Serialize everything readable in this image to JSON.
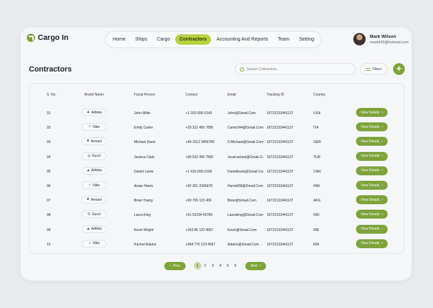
{
  "brand": {
    "name": "Cargo In"
  },
  "nav": {
    "items": [
      "Home",
      "Ships",
      "Cargo",
      "Contractors",
      "Accounting And Reports",
      "Team",
      "Setting"
    ],
    "active": "Contractors"
  },
  "profile": {
    "name": "Mark Wilson",
    "email": "mark642@hotmail.com"
  },
  "page": {
    "title": "Contractors"
  },
  "search": {
    "placeholder": "Search Contractors..."
  },
  "filters": {
    "label": "Filters"
  },
  "add": {
    "label": "+"
  },
  "table": {
    "headers": [
      "S. No.",
      "Brand Name",
      "Facial Person",
      "Contact",
      "Email",
      "Tracking ID",
      "Country"
    ],
    "action_label": "View Details",
    "rows": [
      {
        "sno": "01",
        "brand": "Adidas",
        "brand_icon": "adidas-icon",
        "person": "John Miller",
        "contact": "+1 202-555-0143",
        "email": "John@Gmail.Com",
        "tracking": "16722133441137",
        "country": "USA"
      },
      {
        "sno": "02",
        "brand": "Nike",
        "brand_icon": "nike-icon",
        "person": "Emily Carter",
        "contact": "+39 312 456 7890",
        "email": "Carter244@Gmail.Com",
        "tracking": "16722133441137",
        "country": "ITA"
      },
      {
        "sno": "03",
        "brand": "Armani",
        "brand_icon": "armani-icon",
        "person": "Michael Davis",
        "contact": "+49 1512 3456789",
        "email": "D.Michael@Gmail.Com",
        "tracking": "16722133441137",
        "country": "GER"
      },
      {
        "sno": "04",
        "brand": "Gucci",
        "brand_icon": "gucci-icon",
        "person": "Jessica Clark",
        "contact": "+90 532 456 7890",
        "email": "Jessicaclark@Gmail.Com",
        "tracking": "16722133441137",
        "country": "TUR"
      },
      {
        "sno": "05",
        "brand": "Adidas",
        "brand_icon": "adidas-icon",
        "person": "Daniel Lewis",
        "contact": "+1 416-555-0198",
        "email": "Daniellewis@Gmail.Com",
        "tracking": "16722133441137",
        "country": "CAN"
      },
      {
        "sno": "06",
        "brand": "Nike",
        "brand_icon": "nike-icon",
        "person": "Aman Harris",
        "contact": "+92 301 2345678",
        "email": "Harris658@Gmail.Com",
        "tracking": "16722133441137",
        "country": "PAK"
      },
      {
        "sno": "07",
        "brand": "Armani",
        "brand_icon": "armani-icon",
        "person": "Brian Young",
        "contact": "+93 700 123 456",
        "email": "Brian@Gmail.Com",
        "tracking": "16722133441137",
        "country": "AFG"
      },
      {
        "sno": "08",
        "brand": "Gucci",
        "brand_icon": "gucci-icon",
        "person": "Laura King",
        "contact": "+91 91234 56789",
        "email": "Lauraking@Gmail.Com",
        "tracking": "16722133441137",
        "country": "IND"
      },
      {
        "sno": "09",
        "brand": "Adidas",
        "brand_icon": "adidas-icon",
        "person": "Kevin Wright",
        "contact": "+353 85 123 4567",
        "email": "Kevin@Gmail.Com",
        "tracking": "16722133441137",
        "country": "IRE"
      },
      {
        "sno": "10",
        "brand": "Nike",
        "brand_icon": "nike-icon",
        "person": "Rachel Adams",
        "contact": "+964 770 123 4567",
        "email": "Adams@Gmail.Com",
        "tracking": "16722133441137",
        "country": "IRA"
      }
    ]
  },
  "pagination": {
    "prev": "Prev",
    "next": "Next",
    "pages": [
      "1",
      "2",
      "3",
      "4",
      "5",
      "6"
    ],
    "current": "1"
  },
  "colors": {
    "accent": "#7da33a",
    "nav_active": "#b6d23d",
    "background": "#e9ebee"
  }
}
